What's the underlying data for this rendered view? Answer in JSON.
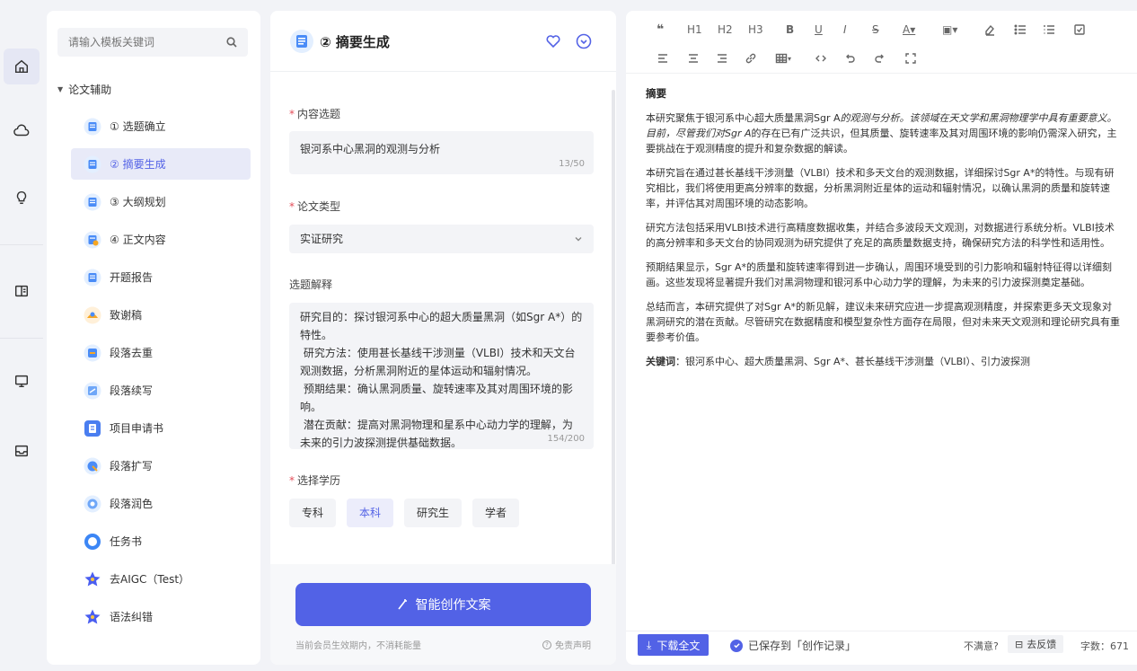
{
  "colors": {
    "accent": "#5262e6",
    "required": "#e34d59"
  },
  "rail": {
    "items": [
      "home-icon",
      "cloud-icon",
      "bulb-icon",
      "book-icon",
      "monitor-icon",
      "inbox-icon"
    ]
  },
  "templates": {
    "search_placeholder": "请输入模板关键词",
    "category": "论文辅助",
    "items": [
      {
        "label": "① 选题确立",
        "icon": "doc-blue-icon"
      },
      {
        "label": "② 摘要生成",
        "icon": "doc-blue-icon",
        "active": true
      },
      {
        "label": "③ 大纲规划",
        "icon": "doc-blue-icon"
      },
      {
        "label": "④ 正文内容",
        "icon": "doc-orange-icon"
      },
      {
        "label": "开题报告",
        "icon": "doc-blue-icon"
      },
      {
        "label": "致谢稿",
        "icon": "thanks-icon"
      },
      {
        "label": "段落去重",
        "icon": "dedupe-icon"
      },
      {
        "label": "段落续写",
        "icon": "continue-icon"
      },
      {
        "label": "项目申请书",
        "icon": "project-icon"
      },
      {
        "label": "段落扩写",
        "icon": "expand-icon"
      },
      {
        "label": "段落润色",
        "icon": "polish-icon"
      },
      {
        "label": "任务书",
        "icon": "task-icon"
      },
      {
        "label": "去AIGC（Test）",
        "icon": "star-icon"
      },
      {
        "label": "语法纠错",
        "icon": "star-icon"
      }
    ]
  },
  "form": {
    "title": "② 摘要生成",
    "topic_label": "内容选题",
    "topic_value": "银河系中心黑洞的观测与分析",
    "topic_count": "13/50",
    "type_label": "论文类型",
    "type_value": "实证研究",
    "explain_label": "选题解释",
    "explain_lines": [
      "研究目的：探讨银河系中心的超大质量黑洞（如Sgr A*）的特性。",
      " 研究方法：使用甚长基线干涉测量（VLBI）技术和天文台观测数据，分析黑洞附近的星体运动和辐射情况。",
      " 预期结果：确认黑洞质量、旋转速率及其对周围环境的影响。",
      " 潜在贡献：提高对黑洞物理和星系中心动力学的理解，为未来的引力波探测提供基础数据。"
    ],
    "explain_count": "154/200",
    "edu_label": "选择学历",
    "edu_options": [
      "专科",
      "本科",
      "研究生",
      "学者"
    ],
    "edu_selected": "本科",
    "generate_label": "智能创作文案",
    "note": "当前会员生效期内，不消耗能量",
    "disclaimer": "免责声明"
  },
  "editor": {
    "toolbar_row1": [
      "❝",
      "H1",
      "H2",
      "H3",
      "B",
      "U",
      "I",
      "S",
      "A▾",
      "▣▾",
      "eraser",
      "ul",
      "ol",
      "check"
    ],
    "toolbar_row2": [
      "align-left",
      "align-center",
      "align-right",
      "link",
      "table▾",
      "code",
      "undo",
      "redo",
      "fullscreen"
    ],
    "heading": "摘要",
    "p1_plain": "本研究聚焦于银河系中心超大质量黑洞Sgr A",
    "p1_italic": "的观测与分析。该领域在天文学和黑洞物理学中具有重要意义。目前，尽管我们对Sgr A",
    "p1_rest": "的存在已有广泛共识，但其质量、旋转速率及其对周围环境的影响仍需深入研究，主要挑战在于观测精度的提升和复杂数据的解读。",
    "p2": "本研究旨在通过甚长基线干涉测量（VLBI）技术和多天文台的观测数据，详细探讨Sgr A*的特性。与现有研究相比，我们将使用更高分辨率的数据，分析黑洞附近星体的运动和辐射情况，以确认黑洞的质量和旋转速率，并评估其对周围环境的动态影响。",
    "p3": "研究方法包括采用VLBI技术进行高精度数据收集，并结合多波段天文观测，对数据进行系统分析。VLBI技术的高分辨率和多天文台的协同观测为研究提供了充足的高质量数据支持，确保研究方法的科学性和适用性。",
    "p4": "预期结果显示，Sgr A*的质量和旋转速率得到进一步确认，周围环境受到的引力影响和辐射特征得以详细刻画。这些发现将显著提升我们对黑洞物理和银河系中心动力学的理解，为未来的引力波探测奠定基础。",
    "p5": "总结而言，本研究提供了对Sgr A*的新见解，建议未来研究应进一步提高观测精度，并探索更多天文现象对黑洞研究的潜在贡献。尽管研究在数据精度和模型复杂性方面存在局限，但对未来天文观测和理论研究具有重要参考价值。",
    "kw_label": "关键词",
    "kw_value": "：银河系中心、超大质量黑洞、Sgr A*、甚长基线干涉测量（VLBI）、引力波探测",
    "download": "下载全文",
    "saved": "已保存到「创作记录」",
    "unsatisfied": "不满意?",
    "feedback": "去反馈",
    "wordcount": "字数：671"
  }
}
